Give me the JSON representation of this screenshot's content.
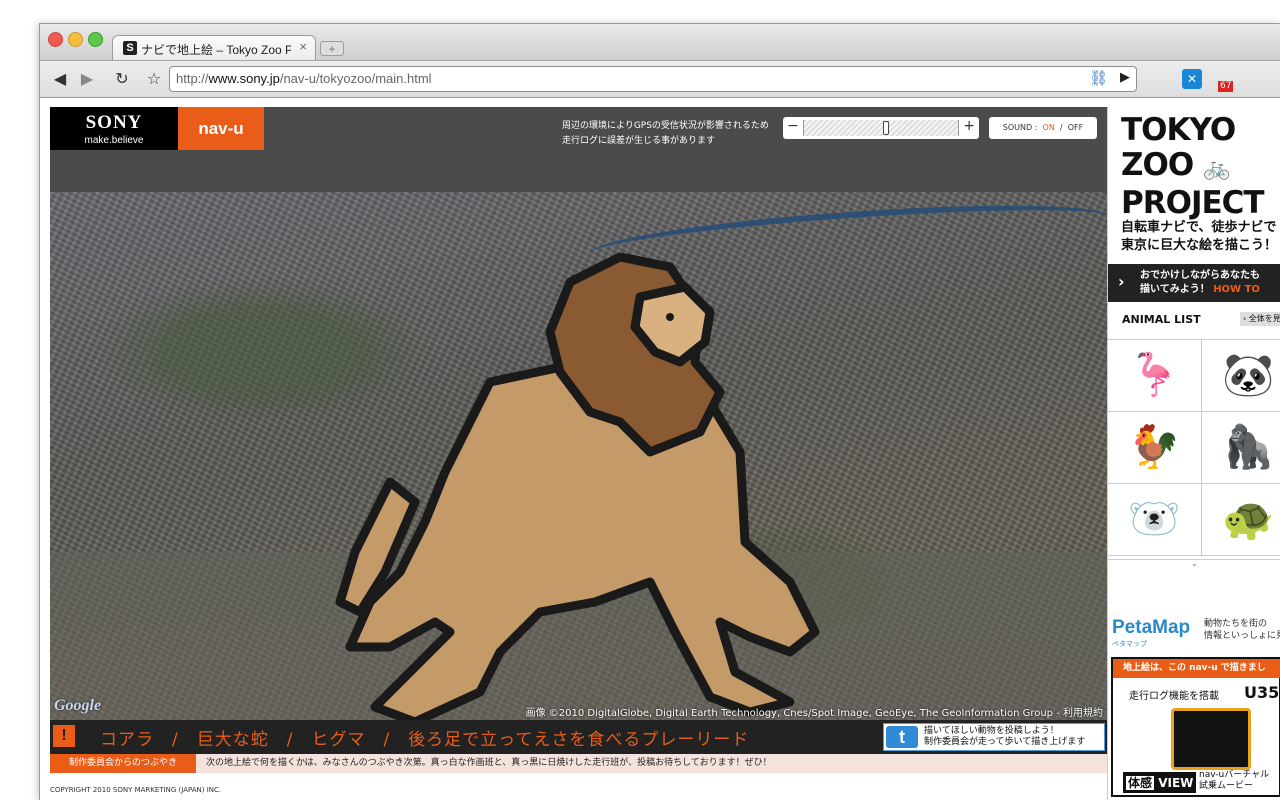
{
  "browser": {
    "tab_title": "ナビで地上絵 – Tokyo Zoo Pro",
    "tab_favicon": "S",
    "tab_close": "×",
    "new_tab": "+",
    "url_prefix": "http://",
    "url_domain": "www.sony.jp",
    "url_path": "/nav-u/tokyozoo/main.html",
    "back_icon": "◀",
    "forward_icon": "▶",
    "reload_icon": "↻",
    "star_icon": "☆",
    "link_icon": "⛓",
    "play_icon": "▶",
    "ext_icon_1": "✕",
    "ext_badge": "67"
  },
  "header": {
    "brand": "SONY",
    "brand_tagline": "make.believe",
    "product": "nav-u",
    "notice_line1": "周辺の環境によりGPSの受信状況が影響されるため",
    "notice_line2": "走行ログに誤差が生じる事があります",
    "zoom_minus": "−",
    "zoom_plus": "+",
    "sound_label": "SOUND :",
    "sound_on": "ON",
    "sound_sep": "/",
    "sound_off": "OFF"
  },
  "map": {
    "google_logo": "Google",
    "credit": "画像 ©2010 DigitalGlobe, Digital Earth Technology, Cnes/Spot Image, GeoEye, The GeoInformation Group - 利用規約",
    "drawing": "lion"
  },
  "ticker": {
    "icon": "!",
    "names": "コアラ　/　巨大な蛇　/　ヒグマ　/　後ろ足で立ってえさを食べるプレーリード",
    "twitter_line1": "描いてほしい動物を投稿しよう！",
    "twitter_line2": "制作委員会が走って歩いて描き上げます",
    "sub_label": "制作委員会からのつぶやき",
    "sub_message": "次の地上絵で何を描くかは、みなさんのつぶやき次第。真っ白な作画班と、真っ黒に日焼けした走行班が、投稿お待ちしております！ぜひ！"
  },
  "footer": {
    "copyright": "COPYRIGHT 2010 SONY MARKETING (JAPAN) INC."
  },
  "side": {
    "title_l1": "TOKYO",
    "title_l2": "ZOO",
    "title_l3": "PROJECT",
    "bike_icon": "🚲",
    "subtitle_l1": "自転車ナビで、徒歩ナビで",
    "subtitle_l2": "東京に巨大な絵を描こう！",
    "howto_l1": "おでかけしながらあなたも",
    "howto_l2": "描いてみよう！",
    "howto_link": "HOW TO",
    "animal_list": "ANIMAL LIST",
    "view_all": "› 全体を見",
    "animals": [
      "🦩",
      "🐼",
      "🐓",
      "🦍",
      "🐻‍❄️",
      "🐢"
    ],
    "petamap": "PetaMap",
    "petamap_sub": "ペタマップ",
    "petamap_desc_l1": "動物たちを街の",
    "petamap_desc_l2": "情報といっしょに見",
    "ad_header": "地上絵は、この",
    "ad_header_brand": "nav-u",
    "ad_header_tail": "で描きまし",
    "ad_feature": "走行ログ機能を搭載",
    "ad_model": "U35",
    "ad_taiken": "体感",
    "ad_view": "VIEW",
    "ad_desc_l1": "nav-uバーチャル",
    "ad_desc_l2": "試乗ムービー"
  }
}
